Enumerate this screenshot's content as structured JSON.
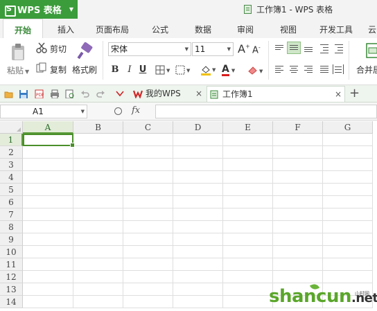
{
  "app": {
    "name": "WPS 表格",
    "window_title": "工作簿1 - WPS 表格",
    "accent": "#3a9c3a"
  },
  "menu": {
    "tabs": [
      "开始",
      "插入",
      "页面布局",
      "公式",
      "数据",
      "审阅",
      "视图",
      "开发工具",
      "云"
    ],
    "active": "开始"
  },
  "ribbon": {
    "paste_label": "粘贴",
    "cut_label": "剪切",
    "copy_label": "复制",
    "format_painter_label": "格式刷",
    "font_name": "宋体",
    "font_size": "11",
    "grow_font": "A",
    "shrink_font": "A",
    "bold": "B",
    "italic": "I",
    "underline": "U",
    "font_color_glyph": "A",
    "merge_label": "合并居"
  },
  "doc_tabs": [
    {
      "label": "我的WPS"
    },
    {
      "label": "工作簿1"
    }
  ],
  "formula_bar": {
    "cell_ref": "A1",
    "fx": "fx",
    "value": ""
  },
  "sheet": {
    "columns": [
      "A",
      "B",
      "C",
      "D",
      "E",
      "F",
      "G"
    ],
    "rows": [
      "1",
      "2",
      "3",
      "4",
      "5",
      "6",
      "7",
      "8",
      "9",
      "10",
      "11",
      "12",
      "13",
      "14"
    ],
    "selected_cell": "A1"
  },
  "watermark": {
    "text": "shancun",
    "suffix": ".net",
    "sub": "山村网"
  }
}
